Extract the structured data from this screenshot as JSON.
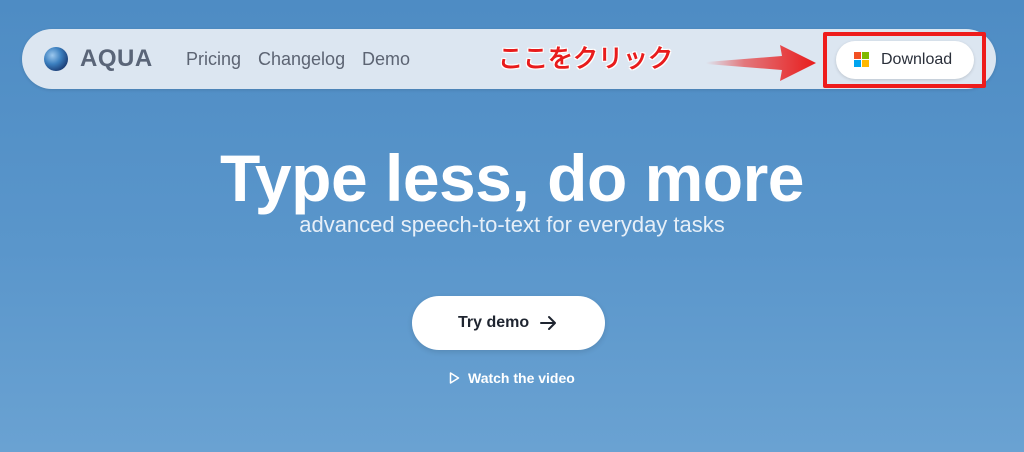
{
  "brand": {
    "name": "AQUA",
    "logo_icon": "aqua-sphere-logo"
  },
  "nav": {
    "links": [
      {
        "label": "Pricing"
      },
      {
        "label": "Changelog"
      },
      {
        "label": "Demo"
      }
    ],
    "download_label": "Download",
    "download_icon": "windows-logo-icon"
  },
  "annotation": {
    "text": "ここをクリック",
    "color": "#e81c1c",
    "box_color": "#ee1c1c"
  },
  "hero": {
    "headline": "Type less, do more",
    "subheadline": "advanced speech-to-text for everyday tasks",
    "primary_cta": {
      "label": "Try demo",
      "icon": "arrow-right-icon"
    },
    "secondary_cta": {
      "label": "Watch the video",
      "icon": "play-icon"
    }
  },
  "colors": {
    "background": "#5a96cb",
    "nav_background": "#dce6f1",
    "windows_logo": [
      "#f25022",
      "#7fba00",
      "#00a4ef",
      "#ffb900"
    ]
  }
}
